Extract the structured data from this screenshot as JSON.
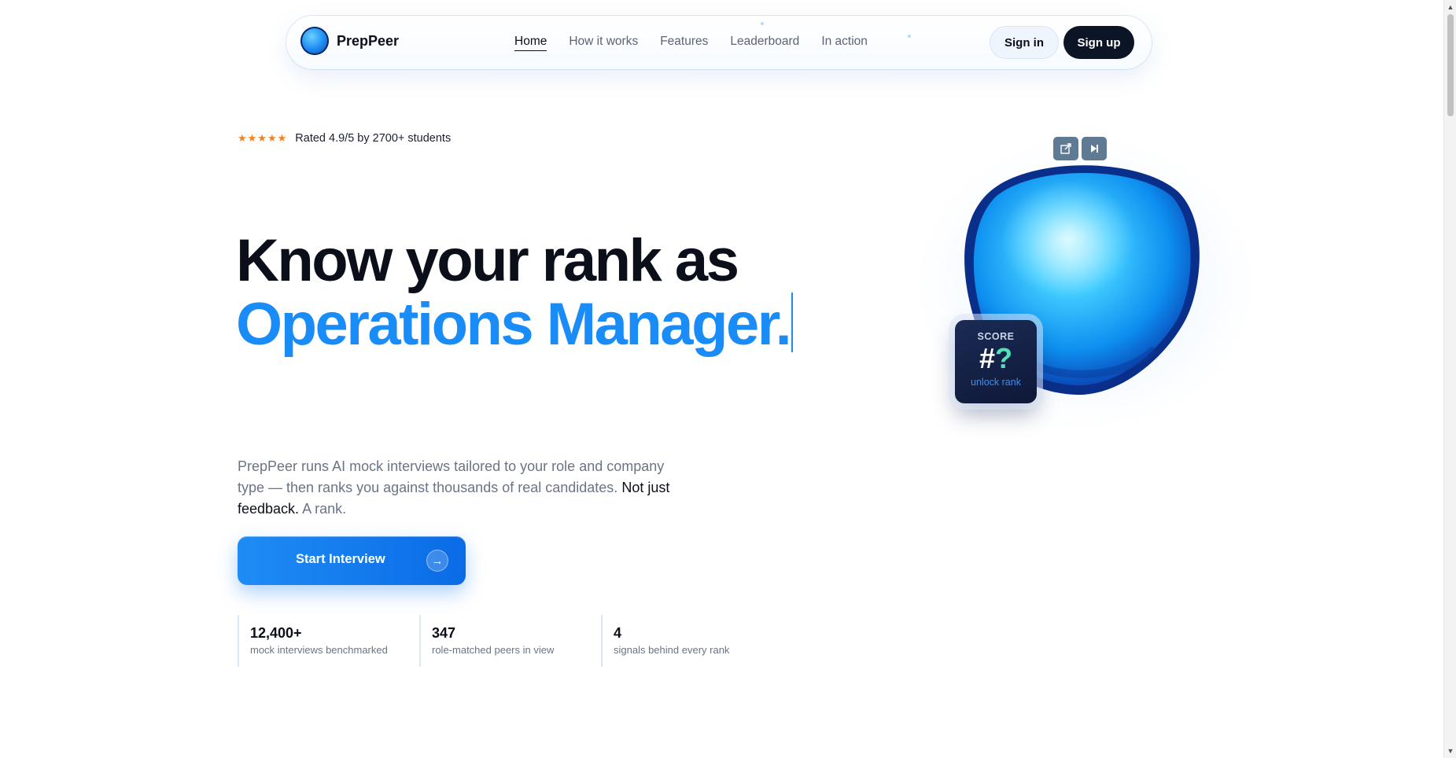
{
  "nav": {
    "brand": "PrepPeer",
    "links": [
      "Home",
      "How it works",
      "Features",
      "Leaderboard",
      "In action"
    ],
    "active_index": 0,
    "sign_in": "Sign in",
    "sign_up": "Sign up"
  },
  "hero": {
    "stars": "★★★★★",
    "rating_text": "Rated 4.9/5 by 2700+ students",
    "headline_line1": "Know your rank as",
    "headline_line2": "Operations Manager.",
    "desc_part1": "PrepPeer runs AI mock interviews tailored to your role and company type — then ranks you against thousands of real candidates.",
    "desc_part2": "Not just feedback.",
    "desc_part3": "A rank.",
    "cta_label": "Start Interview",
    "cta_icon": "arrow-right-icon"
  },
  "stats": [
    {
      "value": "12,400+",
      "label": "mock interviews benchmarked"
    },
    {
      "value": "347",
      "label": "role-matched peers in view"
    },
    {
      "value": "4",
      "label": "signals behind every rank"
    }
  ],
  "score_card": {
    "label": "SCORE",
    "hash": "#",
    "question": "?",
    "sub": "unlock rank"
  },
  "visual_controls": [
    "popout-icon",
    "skip-icon"
  ],
  "colors": {
    "accent": "#1a8cf7",
    "dark": "#0b1526",
    "star": "#f5811f",
    "score_question": "#4fe3b5"
  }
}
